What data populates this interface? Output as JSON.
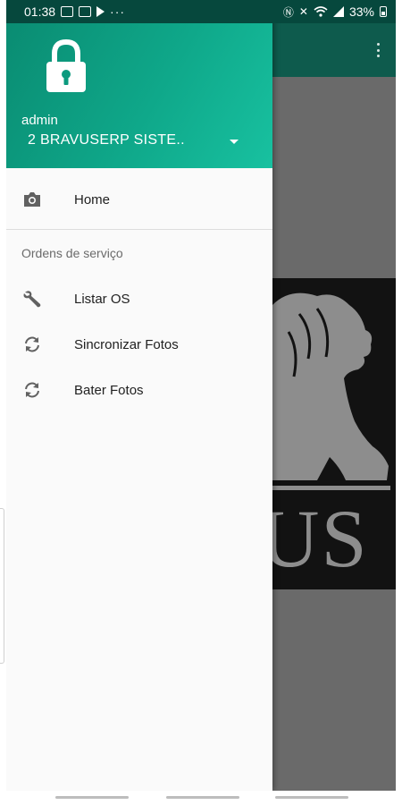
{
  "status_bar": {
    "time": "01:38",
    "more": "···",
    "battery": "33%",
    "left_icons": [
      "image-icon",
      "image-icon",
      "play-store-icon"
    ],
    "right_icons": [
      "nfc-icon",
      "mute-icon",
      "wifi-icon",
      "signal-icon",
      "battery-icon"
    ]
  },
  "drawer": {
    "header": {
      "icon": "lock-icon",
      "account_name": "admin",
      "account_org": "2 BRAVUSERP SISTE..",
      "accent": "#0fa88a"
    },
    "items_top": [
      {
        "icon": "camera-icon",
        "label": "Home"
      }
    ],
    "section": {
      "title": "Ordens de serviço",
      "items": [
        {
          "icon": "wrench-icon",
          "label": "Listar OS"
        },
        {
          "icon": "sync-icon",
          "label": "Sincronizar Fotos"
        },
        {
          "icon": "sync-icon",
          "label": "Bater Fotos"
        }
      ]
    }
  },
  "background_app": {
    "toolbar_color": "#0e5b4d",
    "logo_text": "US",
    "overflow_icon": "more-vert-icon"
  }
}
